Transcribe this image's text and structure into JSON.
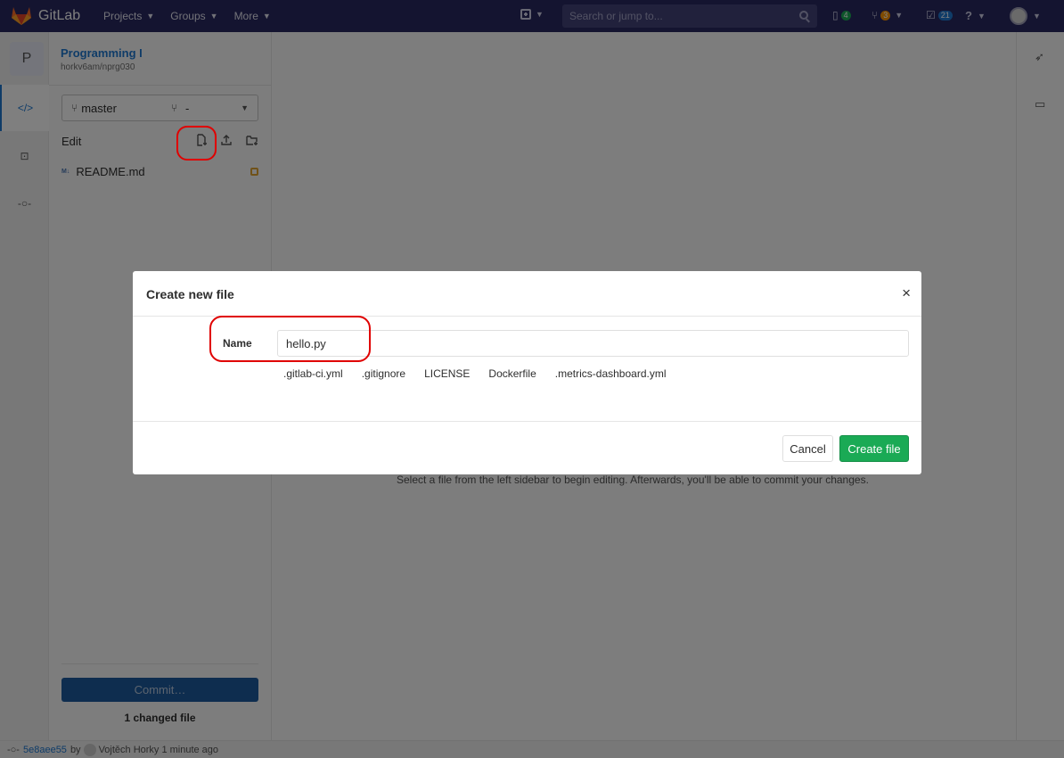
{
  "topnav": {
    "brand": "GitLab",
    "links": [
      {
        "label": "Projects"
      },
      {
        "label": "Groups"
      },
      {
        "label": "More"
      }
    ],
    "search_placeholder": "Search or jump to...",
    "issues_count": "4",
    "mr_count": "3",
    "todo_count": "21",
    "issues_badge_color": "#1aaa55",
    "mr_badge_color": "#fc9403",
    "todo_badge_color": "#1f78d1"
  },
  "project": {
    "avatar_letter": "P",
    "name": "Programming I",
    "path": "horkv6am/nprg030"
  },
  "branch": {
    "name": "master",
    "mr": "-"
  },
  "panel": {
    "edit_label": "Edit",
    "files": [
      {
        "name": "README.md",
        "icon": "M↓"
      }
    ],
    "commit_label": "Commit…",
    "changed_label": "1 changed file"
  },
  "main": {
    "message": "Select a file from the left sidebar to begin editing. Afterwards, you'll be able to commit your changes."
  },
  "statusbar": {
    "sha": "5e8aee55",
    "by": "by",
    "author": "Vojtěch Horky",
    "time": "1 minute ago"
  },
  "modal": {
    "title": "Create new file",
    "name_label": "Name",
    "name_value": "hello.py",
    "templates": [
      ".gitlab-ci.yml",
      ".gitignore",
      "LICENSE",
      "Dockerfile",
      ".metrics-dashboard.yml"
    ],
    "cancel_label": "Cancel",
    "create_label": "Create file",
    "close_glyph": "×"
  },
  "colors": {
    "nav_bg": "#292961",
    "accent": "#1f78d1",
    "create_btn": "#1aaa55",
    "annotation": "#e00000"
  }
}
